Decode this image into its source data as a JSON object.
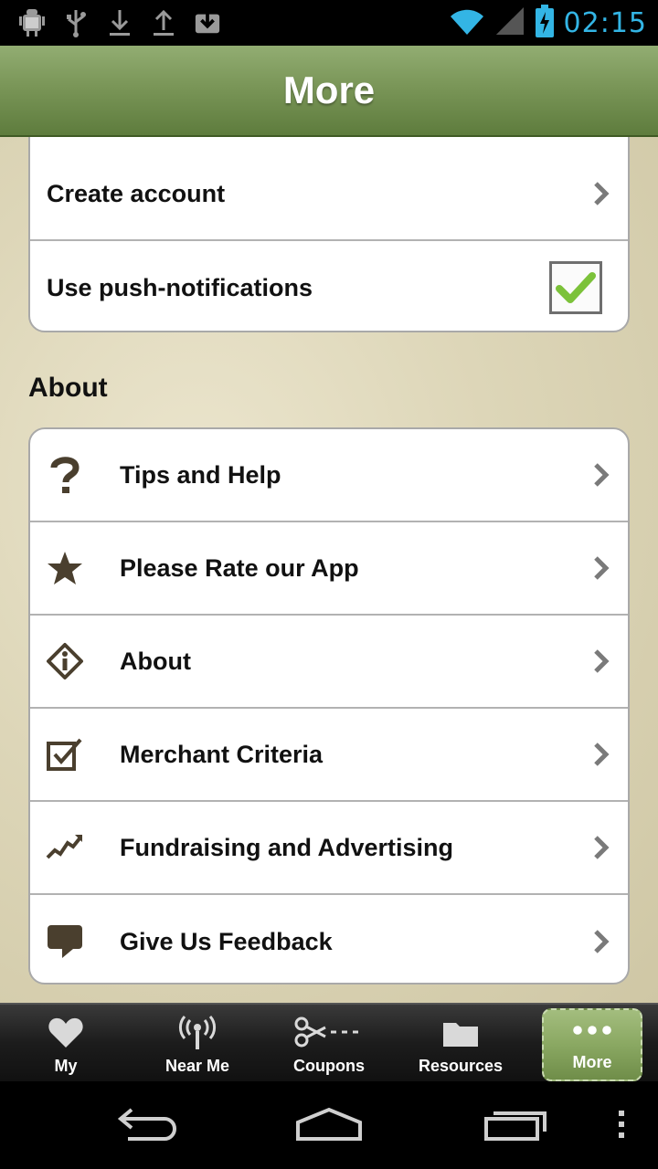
{
  "status_bar": {
    "time": "02:15",
    "icons": [
      "android-debug-icon",
      "usb-icon",
      "download-icon",
      "upload-icon",
      "download-box-icon",
      "wifi-icon",
      "signal-icon",
      "battery-charging-icon"
    ],
    "time_color": "#33b5e5"
  },
  "header": {
    "title": "More"
  },
  "account_card": {
    "items": [
      {
        "label": "Create account",
        "control": "chevron"
      },
      {
        "label": "Use push-notifications",
        "control": "checkbox",
        "checked": true
      }
    ]
  },
  "about_section": {
    "heading": "About",
    "items": [
      {
        "label": "Tips and Help",
        "icon": "question-mark-icon"
      },
      {
        "label": "Please Rate our App",
        "icon": "star-icon"
      },
      {
        "label": "About",
        "icon": "info-icon"
      },
      {
        "label": "Merchant Criteria",
        "icon": "checkmark-box-icon"
      },
      {
        "label": "Fundraising and Advertising",
        "icon": "trend-chart-icon"
      },
      {
        "label": "Give Us Feedback",
        "icon": "speech-bubble-icon"
      }
    ]
  },
  "tab_bar": {
    "tabs": [
      {
        "label": "My",
        "icon": "heart-icon"
      },
      {
        "label": "Near Me",
        "icon": "antenna-icon"
      },
      {
        "label": "Coupons",
        "icon": "scissors-icon"
      },
      {
        "label": "Resources",
        "icon": "folder-icon"
      },
      {
        "label": "More",
        "icon": "more-dots-icon",
        "active": true
      }
    ]
  },
  "colors": {
    "header_green": "#7a9658",
    "active_tab_green": "#8aa862",
    "icon_brown": "#4a3f2e"
  }
}
